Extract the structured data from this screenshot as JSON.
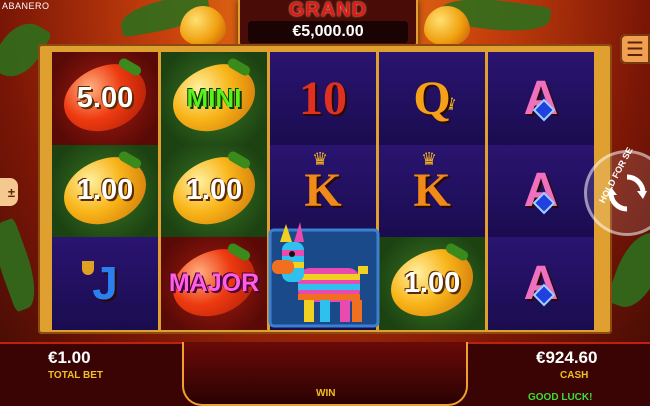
{
  "app": {
    "brand": "ABANERO"
  },
  "jackpot": {
    "title": "GRAND",
    "value": "€5,000.00"
  },
  "reels": [
    [
      {
        "type": "pepper",
        "color": "red",
        "label": "5.00"
      },
      {
        "type": "pepper",
        "color": "gold",
        "label": "1.00"
      },
      {
        "type": "card",
        "symbol": "J"
      }
    ],
    [
      {
        "type": "pepper",
        "color": "gold",
        "label": "MINI"
      },
      {
        "type": "pepper",
        "color": "gold",
        "label": "1.00"
      },
      {
        "type": "pepper",
        "color": "red",
        "label": "MAJOR"
      }
    ],
    [
      {
        "type": "card",
        "symbol": "10"
      },
      {
        "type": "card",
        "symbol": "K"
      },
      {
        "type": "pinata"
      }
    ],
    [
      {
        "type": "card",
        "symbol": "Q"
      },
      {
        "type": "card",
        "symbol": "K"
      },
      {
        "type": "pepper",
        "color": "gold",
        "label": "1.00"
      }
    ],
    [
      {
        "type": "card",
        "symbol": "A"
      },
      {
        "type": "card",
        "symbol": "A"
      },
      {
        "type": "card",
        "symbol": "A"
      }
    ]
  ],
  "controls": {
    "menu_icon": "menu-icon",
    "bet_icon": "bet-adjust-icon",
    "bet_icon_text": "±",
    "spin_hint": "HOLD FOR SE",
    "spin_icon": "spin-arrows-icon"
  },
  "footer": {
    "total_bet_value": "€1.00",
    "total_bet_label": "TOTAL BET",
    "win_label": "WIN",
    "cash_value": "€924.60",
    "cash_label": "CASH",
    "message": "GOOD LUCK!"
  },
  "colors": {
    "accent_gold": "#e0a030",
    "win_green": "#3adc3a",
    "grand_red": "#e01818"
  }
}
